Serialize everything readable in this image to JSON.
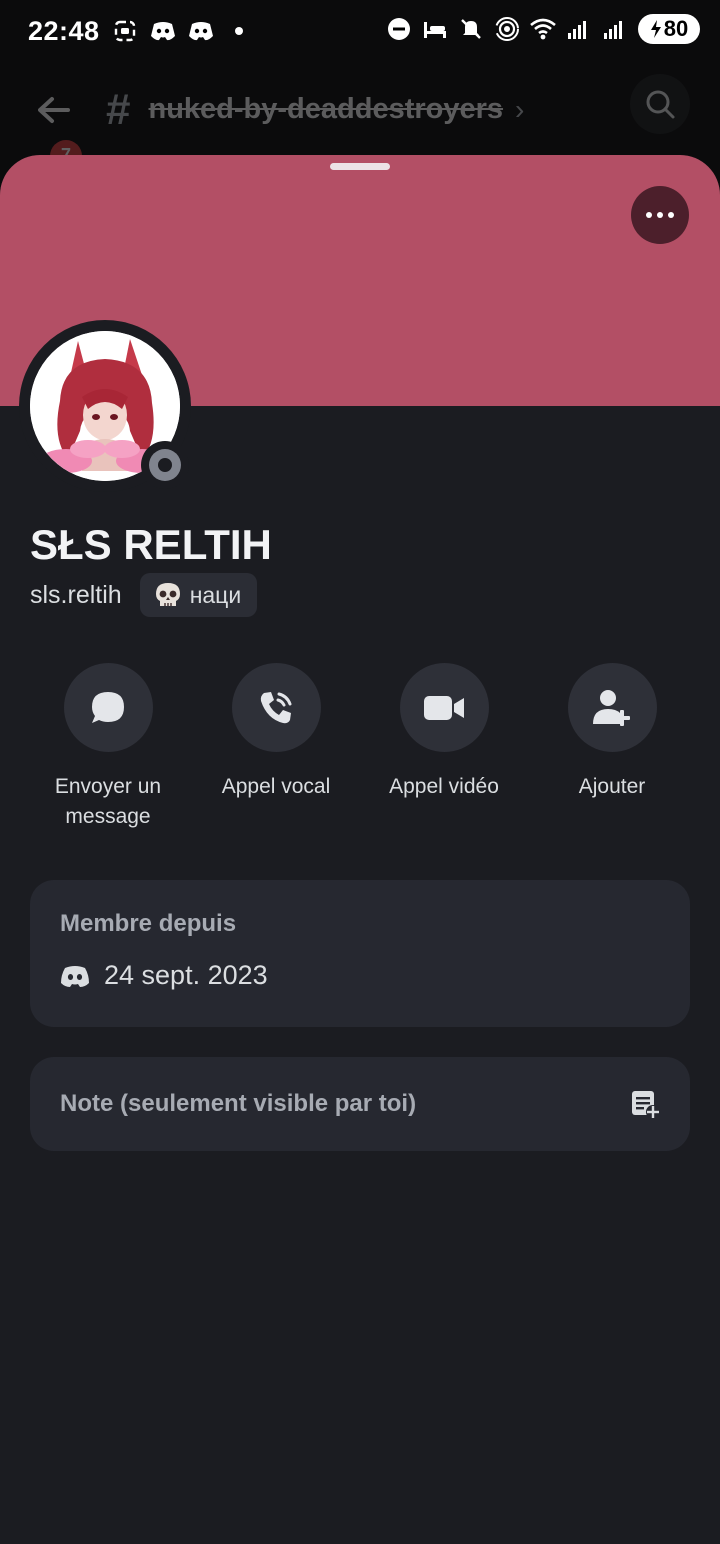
{
  "status_bar": {
    "time": "22:48",
    "battery": "80"
  },
  "channel_header": {
    "badge_count": "7",
    "hash_symbol": "#",
    "channel_name": "nuked-by-deaddestroyers"
  },
  "profile": {
    "display_name": "SŁS RELTIH",
    "username": "sls.reltih",
    "tag_text": "наци",
    "status": "offline"
  },
  "actions": [
    {
      "label": "Envoyer un message",
      "icon": "message-icon"
    },
    {
      "label": "Appel vocal",
      "icon": "phone-call-icon"
    },
    {
      "label": "Appel vidéo",
      "icon": "video-icon"
    },
    {
      "label": "Ajouter",
      "icon": "add-friend-icon"
    }
  ],
  "member_since": {
    "title": "Membre depuis",
    "date": "24 sept. 2023"
  },
  "note": {
    "placeholder": "Note (seulement visible par toi)"
  },
  "colors": {
    "banner": "#b34f65",
    "sheet_background": "#1b1c21",
    "card_background": "#262830",
    "action_button": "#2e3038",
    "more_button": "#4c1f2b"
  }
}
